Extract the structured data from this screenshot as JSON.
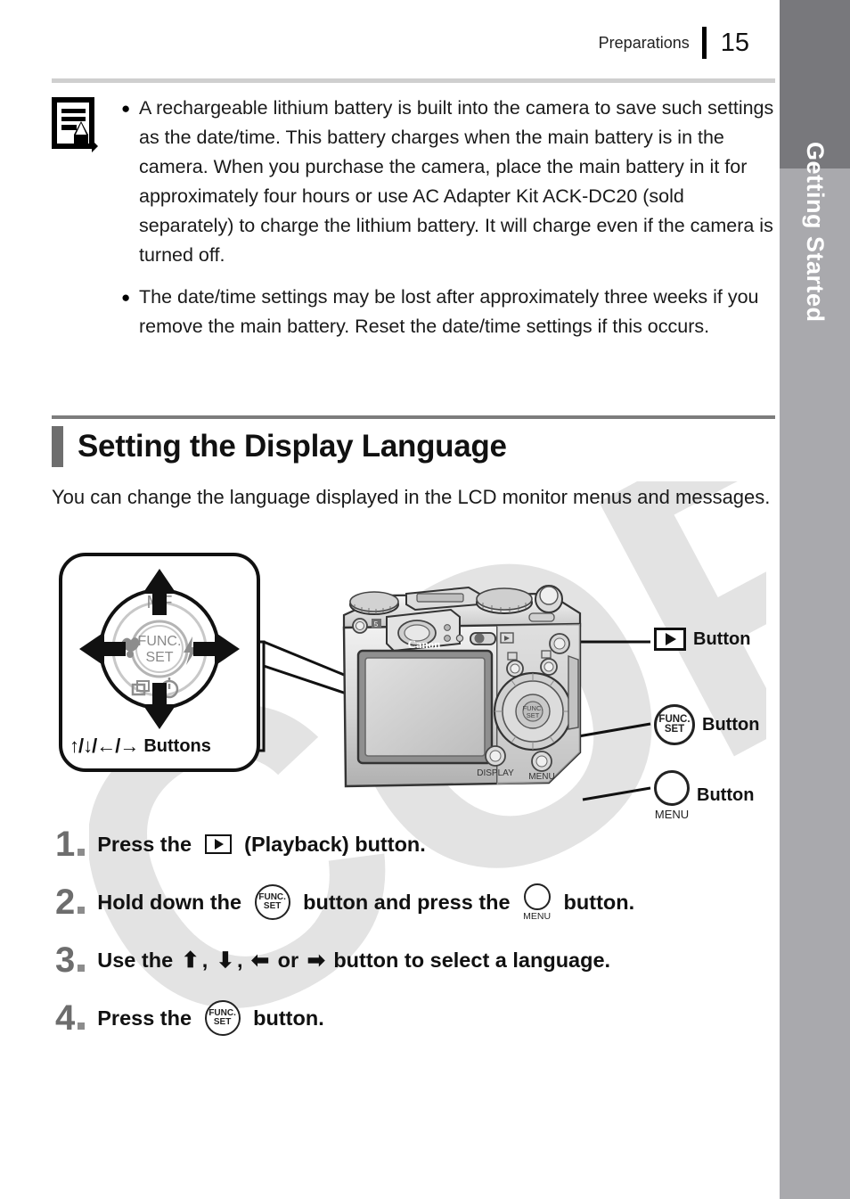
{
  "header": {
    "section_name": "Preparations",
    "page_number": "15"
  },
  "side_tab": {
    "label": "Getting Started"
  },
  "watermark": {
    "text": "COPY"
  },
  "note_box": {
    "icon": "note-memo-icon",
    "bullets": [
      "A rechargeable lithium battery is built into the camera to save such settings as the date/time. This battery charges when the main battery is in the camera. When you purchase the camera, place the main battery in it for approximately four hours or use AC Adapter Kit ACK-DC20 (sold separately) to charge the lithium battery. It will charge even if the camera is turned off.",
      "The date/time settings may be lost after approximately three weeks if you remove the main battery. Reset the date/time settings if this occurs."
    ],
    "bullet_glyph": "●"
  },
  "section": {
    "title": "Setting the Display Language",
    "intro": "You can change the language displayed in the LCD monitor menus and messages."
  },
  "diagram": {
    "controller": {
      "top_label": "MF",
      "center_label_line1": "FUNC.",
      "center_label_line2": "SET",
      "left_icon": "macro-flower-icon",
      "right_icon": "flash-bolt-icon",
      "bottom_left_icon": "drive-mode-icon",
      "bottom_right_icon": "self-timer-icon",
      "caption_arrows": "↑/↓/←/→",
      "caption_word": "Buttons"
    },
    "camera": {
      "brand_label": "Canon",
      "display_label": "DISPLAY",
      "menu_label": "MENU",
      "funcset_line1": "FUNC.",
      "funcset_line2": "SET"
    },
    "callouts": [
      {
        "icon": "playback-icon",
        "label": "Button"
      },
      {
        "icon": "funcset-icon",
        "label": "Button",
        "icon_line1": "FUNC.",
        "icon_line2": "SET"
      },
      {
        "icon": "menu-icon",
        "label": "Button",
        "sub_label": "MENU"
      }
    ]
  },
  "steps": [
    {
      "number": "1",
      "parts": [
        {
          "type": "text",
          "value": "Press the "
        },
        {
          "type": "icon",
          "value": "playback-icon"
        },
        {
          "type": "text",
          "value": " (Playback) button."
        }
      ]
    },
    {
      "number": "2",
      "parts": [
        {
          "type": "text",
          "value": "Hold down the "
        },
        {
          "type": "icon",
          "value": "funcset-icon"
        },
        {
          "type": "text",
          "value": " button and press the "
        },
        {
          "type": "icon",
          "value": "menu-icon"
        },
        {
          "type": "text",
          "value": " button."
        }
      ]
    },
    {
      "number": "3",
      "parts": [
        {
          "type": "text",
          "value": "Use the "
        },
        {
          "type": "icon",
          "value": "arrow-up-icon"
        },
        {
          "type": "text",
          "value": ", "
        },
        {
          "type": "icon",
          "value": "arrow-down-icon"
        },
        {
          "type": "text",
          "value": ", "
        },
        {
          "type": "icon",
          "value": "arrow-left-icon"
        },
        {
          "type": "text",
          "value": " or "
        },
        {
          "type": "icon",
          "value": "arrow-right-icon"
        },
        {
          "type": "text",
          "value": " button to select a language."
        }
      ]
    },
    {
      "number": "4",
      "parts": [
        {
          "type": "text",
          "value": "Press the "
        },
        {
          "type": "icon",
          "value": "funcset-icon"
        },
        {
          "type": "text",
          "value": " button."
        }
      ]
    }
  ],
  "step_labels": {
    "s1_a": "Press the ",
    "s1_b": " (Playback) button.",
    "s2_a": "Hold down the ",
    "s2_b": " button and press the ",
    "s2_c": " button.",
    "s3_a": "Use the ",
    "s3_b": ", ",
    "s3_c": ", ",
    "s3_d": " or ",
    "s3_e": " button to select a language.",
    "s4_a": "Press the ",
    "s4_b": " button.",
    "arrow_up": "⬆",
    "arrow_down": "⬇",
    "arrow_left": "⬅",
    "arrow_right": "➡",
    "num1": "1",
    "num2": "2",
    "num3": "3",
    "num4": "4"
  },
  "colors": {
    "tab_dark": "#78787c",
    "tab_light": "#a9a9ad",
    "section_bar": "#6e6e6e",
    "step_number": "#6d6d6d",
    "watermark": "#e3e3e3"
  }
}
